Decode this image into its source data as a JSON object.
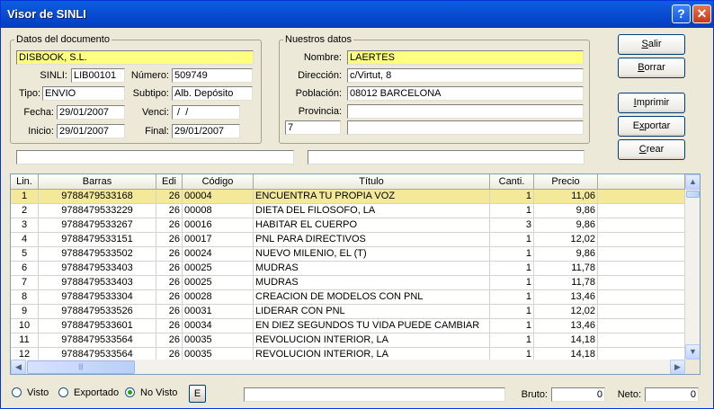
{
  "window": {
    "title": "Visor de SINLI",
    "help_label": "?",
    "close_label": "✕"
  },
  "doc": {
    "legend": "Datos del documento",
    "emisor": "DISBOOK, S.L.",
    "sinli_label": "SINLI:",
    "sinli": "LIB00101",
    "numero_label": "Número:",
    "numero": "509749",
    "tipo_label": "Tipo:",
    "tipo": "ENVIO",
    "subtipo_label": "Subtipo:",
    "subtipo": "Alb. Depósito",
    "fecha_label": "Fecha:",
    "fecha": "29/01/2007",
    "venci_label": "Venci:",
    "venci": " /  /",
    "inicio_label": "Inicio:",
    "inicio": "29/01/2007",
    "final_label": "Final:",
    "final": "29/01/2007"
  },
  "nuestros": {
    "legend": "Nuestros datos",
    "nombre_label": "Nombre:",
    "nombre": "LAERTES",
    "direccion_label": "Dirección:",
    "direccion": "c/Virtut, 8",
    "poblacion_label": "Población:",
    "poblacion": "08012 BARCELONA",
    "provincia_label": "Provincia:",
    "provincia": "",
    "codigo": "7",
    "extra": ""
  },
  "buttons": {
    "salir_u": "S",
    "salir_rest": "alir",
    "borrar_u": "B",
    "borrar_rest": "orrar",
    "imprimir_u": "I",
    "imprimir_rest": "mprimir",
    "exportar_pre": "E",
    "exportar_u": "x",
    "exportar_rest": "portar",
    "crear_u": "C",
    "crear_rest": "rear"
  },
  "table": {
    "columns": [
      "Lin.",
      "Barras",
      "Edi",
      "Código",
      "Título",
      "Canti.",
      "Precio"
    ],
    "rows": [
      [
        "1",
        "9788479533168",
        "26",
        "00004",
        "ENCUENTRA TU PROPIA VOZ",
        "1",
        "11,06"
      ],
      [
        "2",
        "9788479533229",
        "26",
        "00008",
        "DIETA DEL FILOSOFO, LA",
        "1",
        "9,86"
      ],
      [
        "3",
        "9788479533267",
        "26",
        "00016",
        "HABITAR EL CUERPO",
        "3",
        "9,86"
      ],
      [
        "4",
        "9788479533151",
        "26",
        "00017",
        "PNL PARA DIRECTIVOS",
        "1",
        "12,02"
      ],
      [
        "5",
        "9788479533502",
        "26",
        "00024",
        "NUEVO MILENIO, EL (T)",
        "1",
        "9,86"
      ],
      [
        "6",
        "9788479533403",
        "26",
        "00025",
        "MUDRAS",
        "1",
        "11,78"
      ],
      [
        "7",
        "9788479533403",
        "26",
        "00025",
        "MUDRAS",
        "1",
        "11,78"
      ],
      [
        "8",
        "9788479533304",
        "26",
        "00028",
        "CREACION DE MODELOS CON PNL",
        "1",
        "13,46"
      ],
      [
        "9",
        "9788479533526",
        "26",
        "00031",
        "LIDERAR CON PNL",
        "1",
        "12,02"
      ],
      [
        "10",
        "9788479533601",
        "26",
        "00034",
        "EN DIEZ SEGUNDOS TU VIDA PUEDE CAMBIAR",
        "1",
        "13,46"
      ],
      [
        "11",
        "9788479533564",
        "26",
        "00035",
        "REVOLUCION INTERIOR, LA",
        "1",
        "14,18"
      ],
      [
        "12",
        "9788479533564",
        "26",
        "00035",
        "REVOLUCION INTERIOR, LA",
        "1",
        "14,18"
      ]
    ],
    "selected_row": 0
  },
  "footer": {
    "visto_label": "Visto",
    "exportado_label": "Exportado",
    "novisto_label": "No Visto",
    "e_label": "E",
    "status": "",
    "bruto_label": "Bruto:",
    "bruto": "0",
    "neto_label": "Neto:",
    "neto": "0"
  },
  "icons": {
    "scroll_up": "▲",
    "scroll_down": "▼",
    "scroll_left": "◀",
    "scroll_right": "▶",
    "grip": "|||"
  }
}
